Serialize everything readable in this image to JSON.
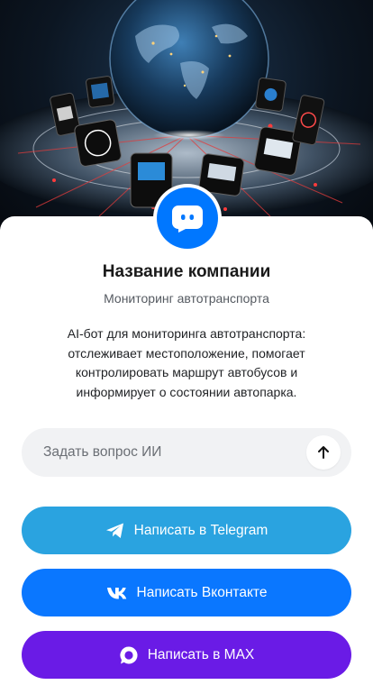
{
  "company": {
    "name": "Название компании",
    "tagline": "Мониторинг автотранспорта",
    "description": "AI-бот для мониторинга автотранспорта: отслеживает местоположение, помогает контролировать маршрут автобусов и информирует о состоянии автопарка."
  },
  "ask": {
    "placeholder": "Задать вопрос ИИ",
    "send_icon": "arrow-up-icon"
  },
  "buttons": {
    "telegram": {
      "label": "Написать в Telegram",
      "icon": "telegram-icon",
      "color": "#2aa3e0"
    },
    "vk": {
      "label": "Написать Вконтакте",
      "icon": "vk-icon",
      "color": "#0a77ff"
    },
    "max": {
      "label": "Написать в MAX",
      "icon": "max-icon",
      "color": "#6a1be6"
    }
  },
  "colors": {
    "accent": "#0077ff",
    "background": "#ffffff"
  }
}
